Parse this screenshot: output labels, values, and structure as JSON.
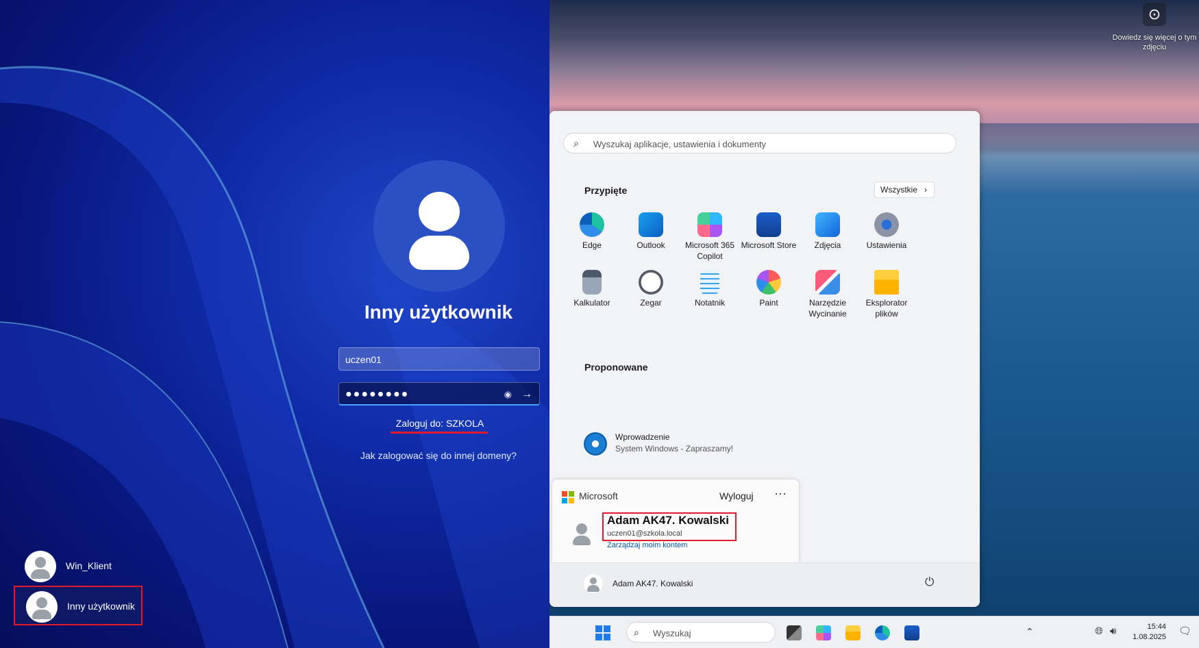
{
  "login": {
    "username_heading": "Inny użytkownik",
    "username_value": "uczen01",
    "password_mask": "●●●●●●●●",
    "reveal_icon": "eye-icon",
    "submit_icon": "arrow-right-icon",
    "sign_in_to": "Zaloguj do: SZKOLA",
    "other_domain_link": "Jak zalogować się do innej domeny?",
    "users": [
      {
        "label": "Win_Klient"
      },
      {
        "label": "Inny użytkownik"
      }
    ]
  },
  "desktop": {
    "learn_more": "Dowiedz się więcej o tym zdjęciu",
    "start": {
      "search_placeholder": "Wyszukaj aplikacje, ustawienia i dokumenty",
      "pinned_title": "Przypięte",
      "all_button": "Wszystkie",
      "pinned": [
        {
          "label": "Edge",
          "icon": "edge-icon"
        },
        {
          "label": "Outlook",
          "icon": "outlook-icon"
        },
        {
          "label": "Microsoft 365 Copilot",
          "icon": "m365-copilot-icon"
        },
        {
          "label": "Microsoft Store",
          "icon": "store-icon"
        },
        {
          "label": "Zdjęcia",
          "icon": "photos-icon"
        },
        {
          "label": "Ustawienia",
          "icon": "settings-icon"
        },
        {
          "label": "Kalkulator",
          "icon": "calculator-icon"
        },
        {
          "label": "Zegar",
          "icon": "clock-icon"
        },
        {
          "label": "Notatnik",
          "icon": "notepad-icon"
        },
        {
          "label": "Paint",
          "icon": "paint-icon"
        },
        {
          "label": "Narzędzie Wycinanie",
          "icon": "snipping-tool-icon"
        },
        {
          "label": "Eksplorator plików",
          "icon": "file-explorer-icon"
        }
      ],
      "recommended_title": "Proponowane",
      "recommended": [
        {
          "title": "Wprowadzenie",
          "subtitle": "System Windows - Zapraszamy!"
        }
      ],
      "account": {
        "brand": "Microsoft",
        "sign_out": "Wyloguj",
        "more": "···",
        "name": "Adam AK47. Kowalski",
        "email": "uczen01@szkola.local",
        "manage": "Zarządzaj moim kontem"
      },
      "footer_user": "Adam AK47. Kowalski",
      "power_icon": "power-icon"
    },
    "taskbar": {
      "search_placeholder": "Wyszukaj",
      "time": "15:44",
      "date": "1.08.2025"
    }
  }
}
